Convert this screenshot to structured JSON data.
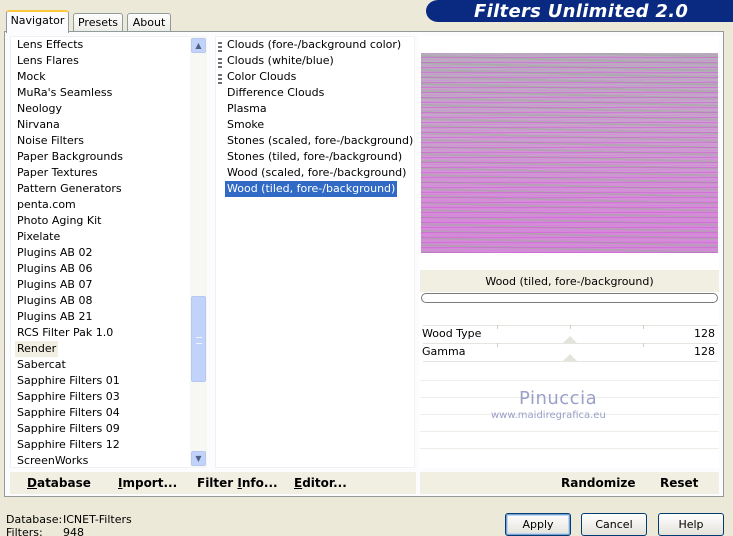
{
  "tabs": [
    {
      "label": "Navigator",
      "active": true
    },
    {
      "label": "Presets",
      "active": false
    },
    {
      "label": "About",
      "active": false
    }
  ],
  "banner": {
    "title": "Filters Unlimited 2.0",
    "color": "#0a2a82"
  },
  "categories": {
    "items": [
      "Lens Effects",
      "Lens Flares",
      "Mock",
      "MuRa's Seamless",
      "Neology",
      "Nirvana",
      "Noise Filters",
      "Paper Backgrounds",
      "Paper Textures",
      "Pattern Generators",
      "penta.com",
      "Photo Aging Kit",
      "Pixelate",
      "Plugins AB 02",
      "Plugins AB 06",
      "Plugins AB 07",
      "Plugins AB 08",
      "Plugins AB 21",
      "RCS Filter Pak 1.0",
      "Render",
      "Sabercat",
      "Sapphire Filters 01",
      "Sapphire Filters 03",
      "Sapphire Filters 04",
      "Sapphire Filters 09",
      "Sapphire Filters 12",
      "ScreenWorks"
    ],
    "selected": "Render"
  },
  "filters": {
    "items": [
      {
        "label": "Clouds (fore-/background color)",
        "marker": true
      },
      {
        "label": "Clouds (white/blue)",
        "marker": true
      },
      {
        "label": "Color Clouds",
        "marker": true
      },
      {
        "label": "Difference Clouds",
        "marker": false
      },
      {
        "label": "Plasma",
        "marker": false
      },
      {
        "label": "Smoke",
        "marker": false
      },
      {
        "label": "Stones (scaled, fore-/background)",
        "marker": false
      },
      {
        "label": "Stones (tiled, fore-/background)",
        "marker": false
      },
      {
        "label": "Wood (scaled, fore-/background)",
        "marker": false
      },
      {
        "label": "Wood (tiled, fore-/background)",
        "marker": false
      }
    ],
    "selected": "Wood (tiled, fore-/background)",
    "selection_color": "#316ac5"
  },
  "preview": {
    "filter_name": "Wood (tiled, fore-/background)",
    "progress": 0
  },
  "params": [
    {
      "label": "Wood Type",
      "value": "128"
    },
    {
      "label": "Gamma",
      "value": "128"
    }
  ],
  "watermark": {
    "name": "Pinuccia",
    "url": "www.maidiregrafica.eu"
  },
  "bottom_bar": {
    "database": {
      "underline": "D",
      "rest": "atabase"
    },
    "import": {
      "underline": "I",
      "rest": "mport..."
    },
    "filter_info": {
      "pre": "Filter ",
      "underline": "I",
      "rest": "nfo..."
    },
    "editor": {
      "underline": "E",
      "rest": "ditor..."
    },
    "randomize": "Randomize",
    "reset": "Reset"
  },
  "status": {
    "database_label": "Database:",
    "database_value": "ICNET-Filters",
    "filters_label": "Filters:",
    "filters_value": "948"
  },
  "buttons": {
    "apply": "Apply",
    "cancel": "Cancel",
    "help": "Help"
  }
}
